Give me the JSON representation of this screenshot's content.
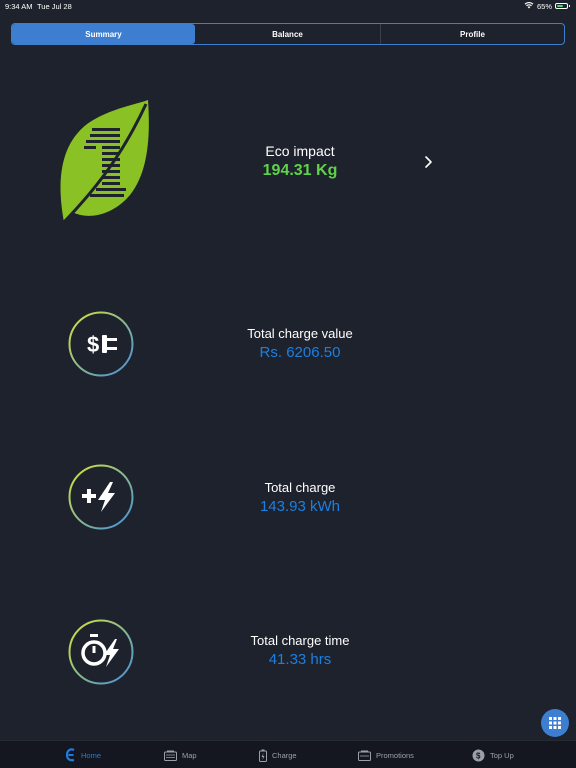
{
  "status_bar": {
    "time": "9:34 AM",
    "date": "Tue Jul 28",
    "battery": "65%",
    "battery_level": 0.65
  },
  "tabs_top": {
    "summary": "Summary",
    "balance": "Balance",
    "profile": "Profile",
    "active": "Summary"
  },
  "eco": {
    "label": "Eco impact",
    "value": "194.31 Kg"
  },
  "charge_value": {
    "label": "Total charge value",
    "value": "Rs. 6206.50"
  },
  "total_charge": {
    "label": "Total charge",
    "value": "143.93 kWh"
  },
  "charge_time": {
    "label": "Total charge time",
    "value": "41.33 hrs"
  },
  "tab_bar": {
    "home": "Home",
    "map": "Map",
    "charge": "Charge",
    "promotions": "Promotions",
    "top_up": "Top Up",
    "active": "Home"
  },
  "colors": {
    "background": "#1e222c",
    "accent_blue": "#3d7ed0",
    "value_blue": "#1b7fe2",
    "eco_green": "#5fd24a",
    "tabbar": "#141720"
  },
  "icons": {
    "eco": "leaf-icon",
    "charge_value": "dollar-plug-icon",
    "total_charge": "plus-lightning-icon",
    "charge_time": "stopwatch-lightning-icon",
    "fab": "grid-icon"
  }
}
